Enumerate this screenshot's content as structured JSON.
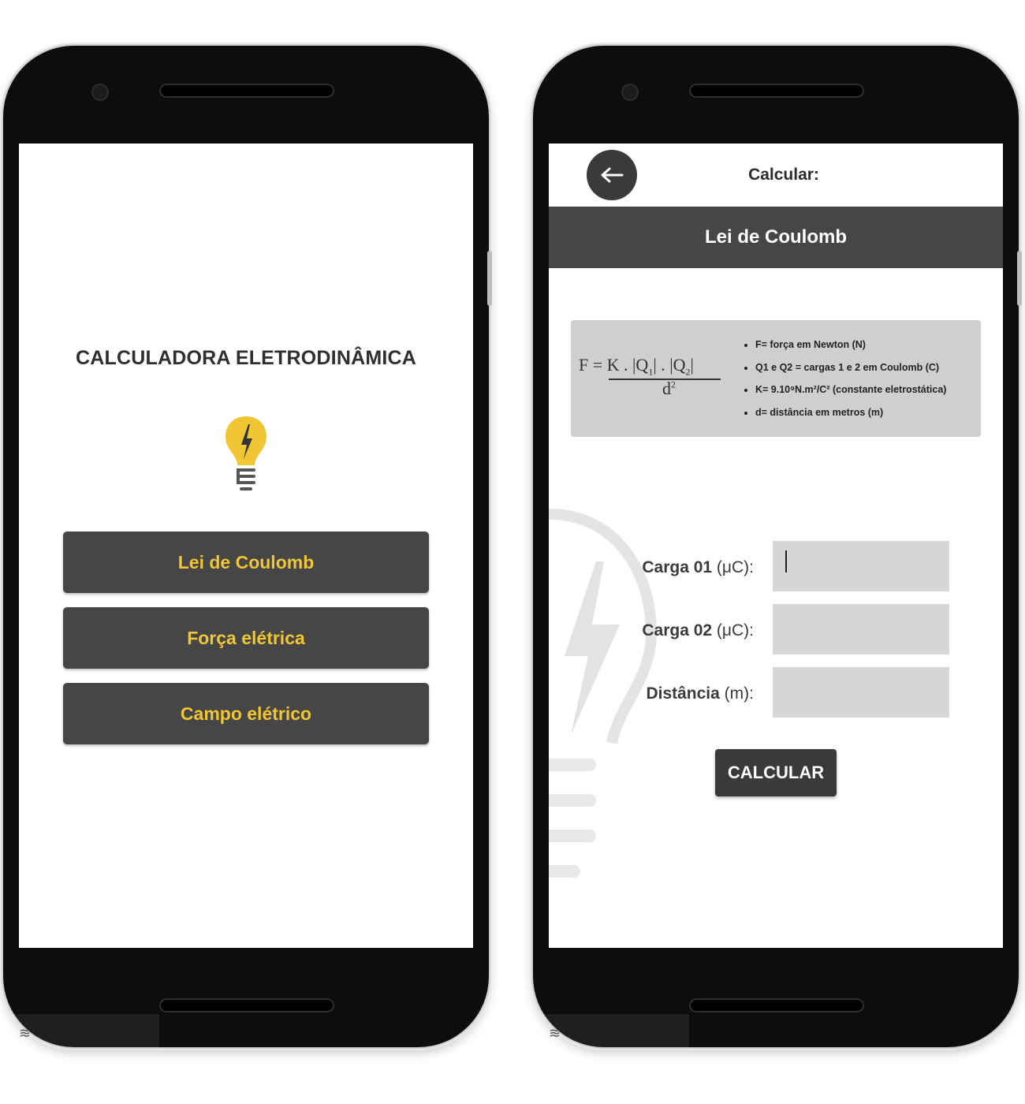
{
  "left_screen": {
    "title": "CALCULADORA ELETRODINÂMICA",
    "bulb_icon": "lightbulb-bolt-icon",
    "menu": [
      {
        "label": "Lei de Coulomb"
      },
      {
        "label": "Força elétrica"
      },
      {
        "label": "Campo elétrico"
      }
    ]
  },
  "right_screen": {
    "back_icon": "arrow-left-icon",
    "topbar_title": "Calcular:",
    "section_title": "Lei de Coulomb",
    "formula": {
      "lhs": "F = K . |Q",
      "sub1": "1",
      "mid": "| . |Q",
      "sub2": "2",
      "end": "|",
      "denominator": "d",
      "exponent": "2"
    },
    "legend": [
      "F= força em Newton (N)",
      "Q1 e Q2 = cargas 1 e 2 em Coulomb (C)",
      "K= 9.10⁹N.m²/C² (constante eletrostática)",
      "d= distância em metros (m)"
    ],
    "fields": [
      {
        "label": "Carga 01",
        "unit": "(μC):",
        "value": ""
      },
      {
        "label": "Carga 02",
        "unit": "(μC):",
        "value": ""
      },
      {
        "label": "Distância",
        "unit": "(m):",
        "value": ""
      }
    ],
    "calc_button": "CALCULAR"
  },
  "colors": {
    "accent_yellow": "#f0c634",
    "button_dark": "#464646",
    "phone_body": "#0d0d0d",
    "input_bg": "#d6d6d6"
  }
}
